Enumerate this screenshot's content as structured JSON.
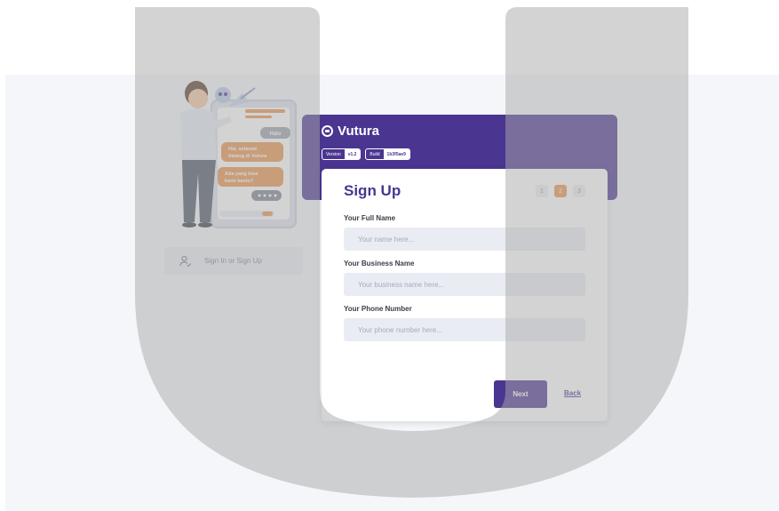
{
  "brand": {
    "name": "Vutura"
  },
  "version_info": {
    "version_key": "Version",
    "version_value": "v1.2",
    "build_key": "Build",
    "build_value": "1b3f5ae9"
  },
  "illustration": {
    "bubble_1": "Halo",
    "bubble_2_line1": "Hai, selamat",
    "bubble_2_line2": "datang di Vutura",
    "bubble_3_line1": "Ada yang bisa",
    "bubble_3_line2": "kami bantu?"
  },
  "sidebar": {
    "signin_label": "Sign In or Sign Up",
    "signin_icon": "user-check-icon"
  },
  "form": {
    "title": "Sign Up",
    "steps": [
      "1",
      "2",
      "3"
    ],
    "active_step": "2",
    "full_name": {
      "label": "Your Full Name",
      "placeholder": "Your name here..."
    },
    "business_name": {
      "label": "Your Business Name",
      "placeholder": "Your business name here..."
    },
    "phone_number": {
      "label": "Your Phone Number",
      "placeholder": "Your phone number here..."
    },
    "next_label": "Next",
    "back_label": "Back"
  },
  "colors": {
    "primary": "#4a3591",
    "accent": "#e8934a",
    "background": "#f4f6fa",
    "input_bg": "#e9ecf3"
  }
}
